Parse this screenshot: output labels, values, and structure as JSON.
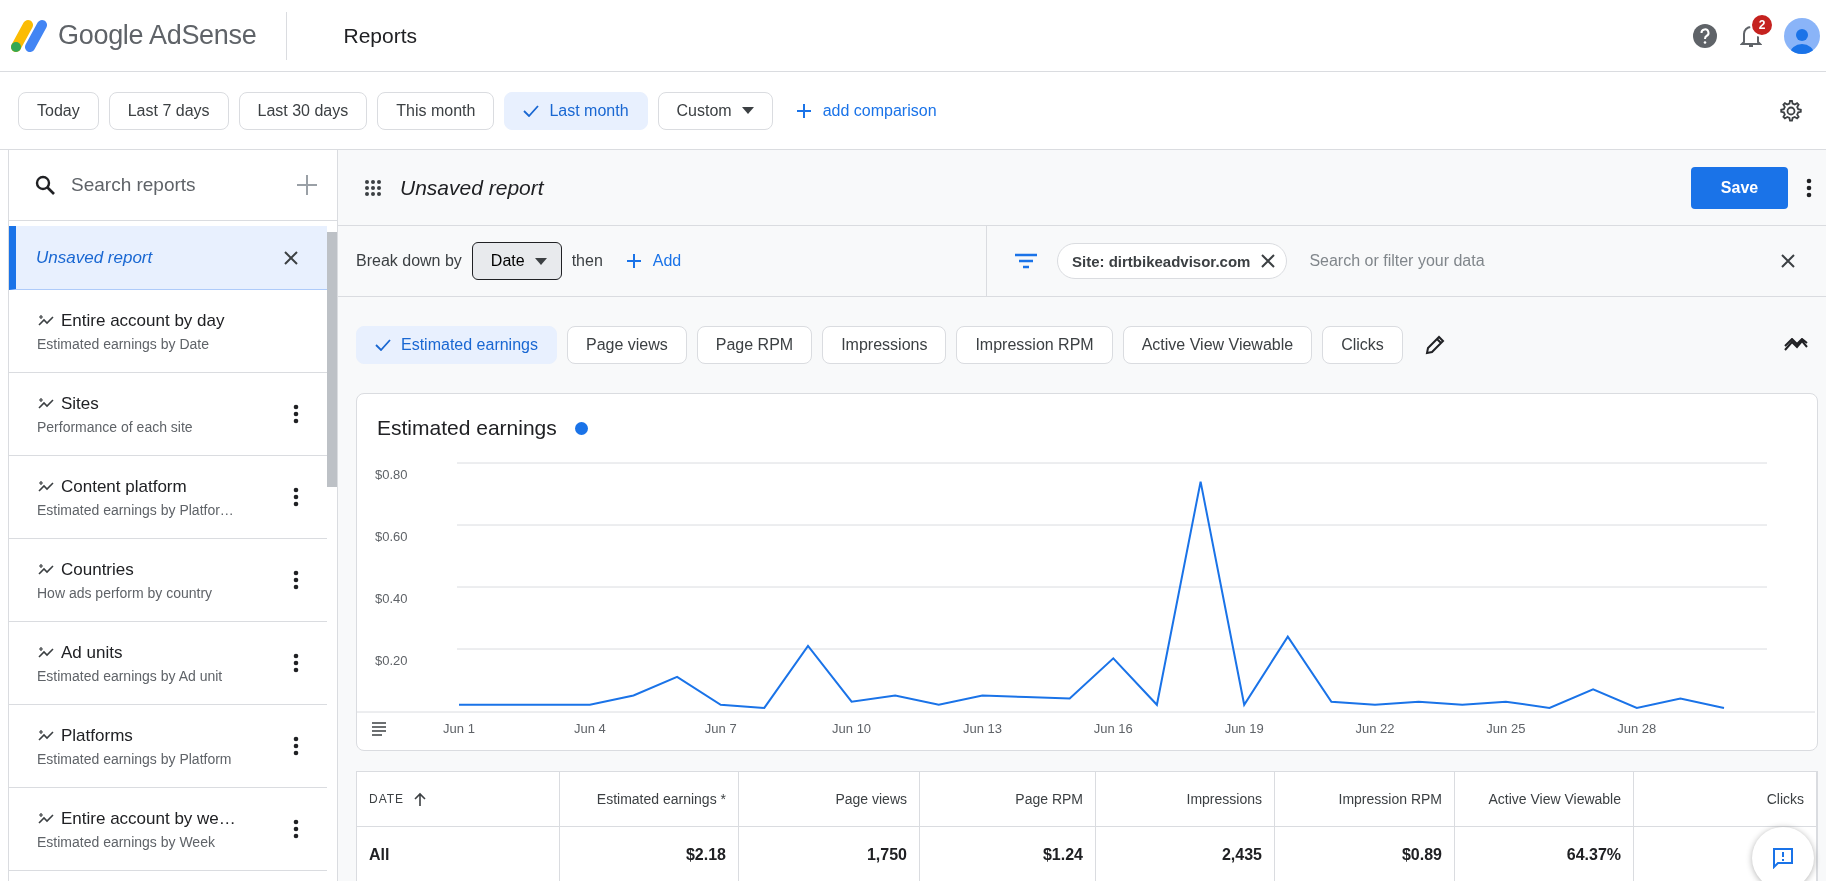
{
  "header": {
    "product_name": "Google AdSense",
    "page_title": "Reports",
    "notification_count": "2"
  },
  "date_ranges": [
    {
      "label": "Today",
      "selected": false,
      "kind": "chip"
    },
    {
      "label": "Last 7 days",
      "selected": false,
      "kind": "chip"
    },
    {
      "label": "Last 30 days",
      "selected": false,
      "kind": "chip"
    },
    {
      "label": "This month",
      "selected": false,
      "kind": "chip"
    },
    {
      "label": "Last month",
      "selected": true,
      "kind": "chip"
    },
    {
      "label": "Custom",
      "selected": false,
      "kind": "dropdown"
    }
  ],
  "add_comparison": "add comparison",
  "sidebar": {
    "search_placeholder": "Search reports",
    "items": [
      {
        "title": "Unsaved report",
        "selected": true,
        "kind": "unsaved"
      },
      {
        "title": "Entire account by day",
        "subtitle": "Estimated earnings by Date",
        "selected": false,
        "kind": "template",
        "menu": false
      },
      {
        "title": "Sites",
        "subtitle": "Performance of each site",
        "selected": false,
        "kind": "template",
        "menu": true
      },
      {
        "title": "Content platform",
        "subtitle": "Estimated earnings by Platfor…",
        "selected": false,
        "kind": "template",
        "menu": true
      },
      {
        "title": "Countries",
        "subtitle": "How ads perform by country",
        "selected": false,
        "kind": "template",
        "menu": true
      },
      {
        "title": "Ad units",
        "subtitle": "Estimated earnings by Ad unit",
        "selected": false,
        "kind": "template",
        "menu": true
      },
      {
        "title": "Platforms",
        "subtitle": "Estimated earnings by Platform",
        "selected": false,
        "kind": "template",
        "menu": true
      },
      {
        "title": "Entire account by we…",
        "subtitle": "Estimated earnings by Week",
        "selected": false,
        "kind": "template",
        "menu": true
      }
    ]
  },
  "report": {
    "title": "Unsaved report",
    "save_button": "Save",
    "breakdown_label": "Break down by",
    "breakdown_value": "Date",
    "then_label": "then",
    "add_label": "Add",
    "filter_chip": "Site: dirtbikeadvisor.com",
    "filter_placeholder": "Search or filter your data"
  },
  "metrics": [
    {
      "label": "Estimated earnings",
      "selected": true
    },
    {
      "label": "Page views",
      "selected": false
    },
    {
      "label": "Page RPM",
      "selected": false
    },
    {
      "label": "Impressions",
      "selected": false
    },
    {
      "label": "Impression RPM",
      "selected": false
    },
    {
      "label": "Active View Viewable",
      "selected": false
    },
    {
      "label": "Clicks",
      "selected": false
    }
  ],
  "chart": {
    "chart_data": {
      "type": "line",
      "categories": [
        "Jun 1",
        null,
        null,
        "Jun 4",
        null,
        null,
        "Jun 7",
        null,
        null,
        "Jun 10",
        null,
        null,
        "Jun 13",
        null,
        null,
        "Jun 16",
        null,
        null,
        "Jun 19",
        null,
        null,
        "Jun 22",
        null,
        null,
        "Jun 25",
        null,
        null,
        "Jun 28",
        null,
        null
      ],
      "grid": true,
      "series": [
        {
          "name": "Estimated earnings",
          "color": "#1a73e8",
          "values": [
            0.02,
            0.02,
            0.02,
            0.02,
            0.05,
            0.11,
            0.02,
            0.01,
            0.21,
            0.03,
            0.05,
            0.02,
            0.05,
            0.045,
            0.04,
            0.17,
            0.02,
            0.74,
            0.02,
            0.24,
            0.03,
            0.02,
            0.03,
            0.02,
            0.03,
            0.01,
            0.07,
            0.01,
            0.04,
            0.01
          ]
        }
      ],
      "ylim": [
        0,
        0.8
      ],
      "yticks": [
        {
          "value": 0.2,
          "label": "$0.20"
        },
        {
          "value": 0.4,
          "label": "$0.40"
        },
        {
          "value": 0.6,
          "label": "$0.60"
        },
        {
          "value": 0.8,
          "label": "$0.80"
        }
      ]
    }
  },
  "table": {
    "columns": [
      {
        "label": "DATE",
        "sorted": true
      },
      {
        "label": "Estimated earnings *",
        "sorted": false
      },
      {
        "label": "Page views",
        "sorted": false
      },
      {
        "label": "Page RPM",
        "sorted": false
      },
      {
        "label": "Impressions",
        "sorted": false
      },
      {
        "label": "Impression RPM",
        "sorted": false
      },
      {
        "label": "Active View Viewable",
        "sorted": false
      },
      {
        "label": "Clicks",
        "sorted": false
      }
    ],
    "rows": [
      {
        "cells": [
          "All",
          "$2.18",
          "1,750",
          "$1.24",
          "2,435",
          "$0.89",
          "64.37%"
        ]
      }
    ]
  }
}
